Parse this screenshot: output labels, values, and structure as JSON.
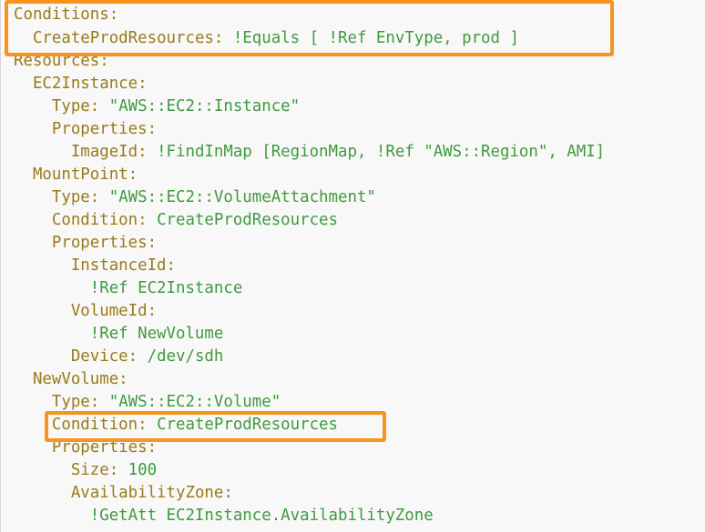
{
  "highlight_color": "#f7941d",
  "key_color": "#9a7a1a",
  "value_color": "#3f9a3f",
  "lines": [
    {
      "indent": "",
      "key": "Conditions:",
      "value": ""
    },
    {
      "indent": "  ",
      "key": "CreateProdResources:",
      "value": " !Equals [ !Ref EnvType, prod ]"
    },
    {
      "indent": "",
      "key": "Resources:",
      "value": ""
    },
    {
      "indent": "  ",
      "key": "EC2Instance:",
      "value": ""
    },
    {
      "indent": "    ",
      "key": "Type:",
      "value": " \"AWS::EC2::Instance\""
    },
    {
      "indent": "    ",
      "key": "Properties:",
      "value": ""
    },
    {
      "indent": "      ",
      "key": "ImageId:",
      "value": " !FindInMap [RegionMap, !Ref \"AWS::Region\", AMI]"
    },
    {
      "indent": "  ",
      "key": "MountPoint:",
      "value": ""
    },
    {
      "indent": "    ",
      "key": "Type:",
      "value": " \"AWS::EC2::VolumeAttachment\""
    },
    {
      "indent": "    ",
      "key": "Condition:",
      "value": " CreateProdResources"
    },
    {
      "indent": "    ",
      "key": "Properties:",
      "value": ""
    },
    {
      "indent": "      ",
      "key": "InstanceId:",
      "value": ""
    },
    {
      "indent": "        ",
      "key": "",
      "value": "!Ref EC2Instance"
    },
    {
      "indent": "      ",
      "key": "VolumeId:",
      "value": ""
    },
    {
      "indent": "        ",
      "key": "",
      "value": "!Ref NewVolume"
    },
    {
      "indent": "      ",
      "key": "Device:",
      "value": " /dev/sdh"
    },
    {
      "indent": "  ",
      "key": "NewVolume:",
      "value": ""
    },
    {
      "indent": "    ",
      "key": "Type:",
      "value": " \"AWS::EC2::Volume\""
    },
    {
      "indent": "    ",
      "key": "Condition:",
      "value": " CreateProdResources"
    },
    {
      "indent": "    ",
      "key": "Properties:",
      "value": ""
    },
    {
      "indent": "      ",
      "key": "Size:",
      "value": " 100"
    },
    {
      "indent": "      ",
      "key": "AvailabilityZone:",
      "value": ""
    },
    {
      "indent": "        ",
      "key": "",
      "value": "!GetAtt EC2Instance.AvailabilityZone"
    }
  ]
}
